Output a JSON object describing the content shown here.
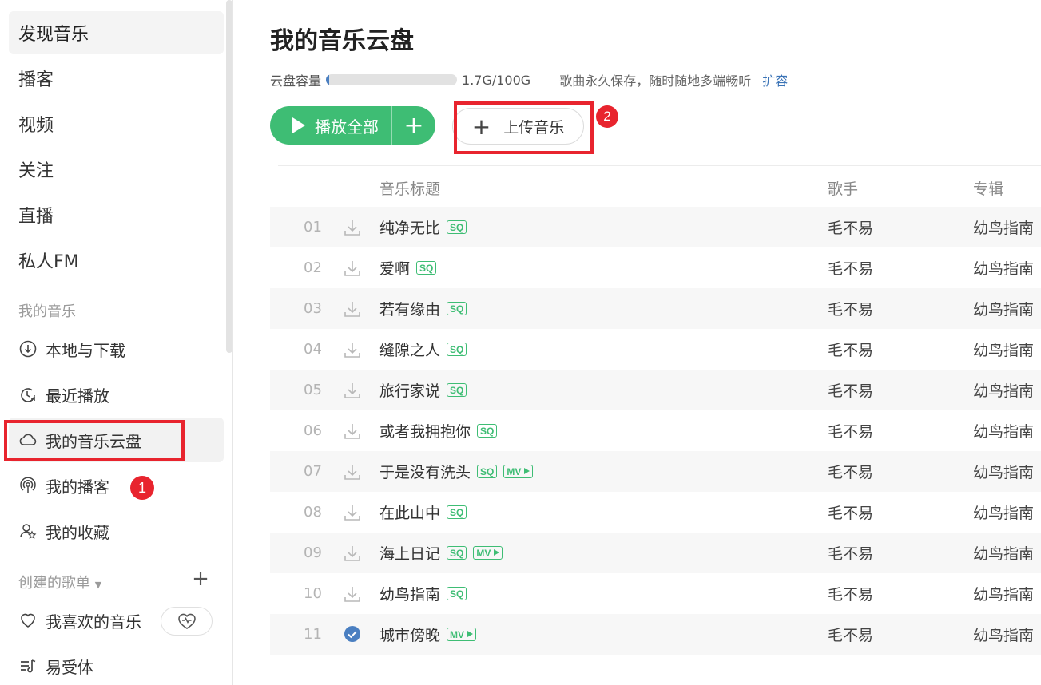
{
  "sidebar": {
    "nav": [
      {
        "label": "发现音乐",
        "active": true
      },
      {
        "label": "播客"
      },
      {
        "label": "视频"
      },
      {
        "label": "关注"
      },
      {
        "label": "直播"
      },
      {
        "label": "私人FM"
      }
    ],
    "my_music_title": "我的音乐",
    "my_music": [
      {
        "label": "本地与下载",
        "icon": "download-circle-icon"
      },
      {
        "label": "最近播放",
        "icon": "recent-clock-icon"
      },
      {
        "label": "我的音乐云盘",
        "icon": "cloud-icon",
        "active": true
      },
      {
        "label": "我的播客",
        "icon": "podcast-icon"
      },
      {
        "label": "我的收藏",
        "icon": "collection-user-icon"
      }
    ],
    "created_title": "创建的歌单",
    "created_add": "+",
    "playlists": [
      {
        "label": "我喜欢的音乐",
        "icon": "heart-icon"
      },
      {
        "label": "易受体",
        "icon": "playlist-icon"
      }
    ],
    "badge_1": "1"
  },
  "main": {
    "title": "我的音乐云盘",
    "capacity_label": "云盘容量",
    "capacity_used_fraction": 0.017,
    "capacity_text": "1.7G/100G",
    "capacity_desc": "歌曲永久保存，随时随地多端畅听",
    "expand_link": "扩容",
    "play_all": "播放全部",
    "play_add": "+",
    "upload": "上传音乐",
    "badge_2": "2",
    "headers": {
      "title": "音乐标题",
      "artist": "歌手",
      "album": "专辑"
    },
    "songs": [
      {
        "num": "01",
        "title": "纯净无比",
        "tags": [
          "SQ"
        ],
        "artist": "毛不易",
        "album": "幼鸟指南"
      },
      {
        "num": "02",
        "title": "爱啊",
        "tags": [
          "SQ"
        ],
        "artist": "毛不易",
        "album": "幼鸟指南"
      },
      {
        "num": "03",
        "title": "若有缘由",
        "tags": [
          "SQ"
        ],
        "artist": "毛不易",
        "album": "幼鸟指南"
      },
      {
        "num": "04",
        "title": "缝隙之人",
        "tags": [
          "SQ"
        ],
        "artist": "毛不易",
        "album": "幼鸟指南"
      },
      {
        "num": "05",
        "title": "旅行家说",
        "tags": [
          "SQ"
        ],
        "artist": "毛不易",
        "album": "幼鸟指南"
      },
      {
        "num": "06",
        "title": "或者我拥抱你",
        "tags": [
          "SQ"
        ],
        "artist": "毛不易",
        "album": "幼鸟指南"
      },
      {
        "num": "07",
        "title": "于是没有洗头",
        "tags": [
          "SQ",
          "MV"
        ],
        "artist": "毛不易",
        "album": "幼鸟指南"
      },
      {
        "num": "08",
        "title": "在此山中",
        "tags": [
          "SQ"
        ],
        "artist": "毛不易",
        "album": "幼鸟指南"
      },
      {
        "num": "09",
        "title": "海上日记",
        "tags": [
          "SQ",
          "MV"
        ],
        "artist": "毛不易",
        "album": "幼鸟指南"
      },
      {
        "num": "10",
        "title": "幼鸟指南",
        "tags": [
          "SQ"
        ],
        "artist": "毛不易",
        "album": "幼鸟指南"
      },
      {
        "num": "11",
        "title": "城市傍晚",
        "tags": [
          "MV"
        ],
        "artist": "毛不易",
        "album": "幼鸟指南",
        "downloaded": true
      }
    ]
  },
  "colors": {
    "accent": "#3ebd74",
    "annotation": "#e8242e",
    "link": "#3a73b6",
    "check": "#4a7fc1"
  }
}
